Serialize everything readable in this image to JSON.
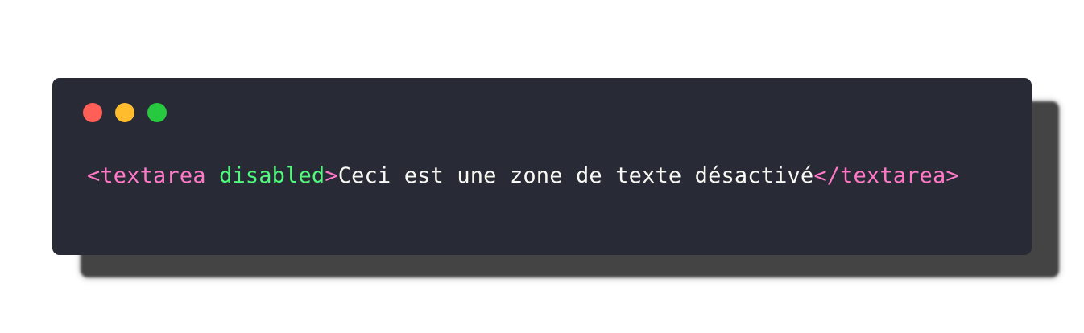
{
  "colors": {
    "window_bg": "#282a36",
    "shadow": "#444444",
    "close": "#ff5f56",
    "minimize": "#ffbd2e",
    "maximize": "#27c93f",
    "tag": "#ff79c6",
    "attribute": "#50fa7b",
    "text": "#f8f8f2"
  },
  "window_controls": [
    {
      "name": "close",
      "icon": "red-dot"
    },
    {
      "name": "minimize",
      "icon": "yellow-dot"
    },
    {
      "name": "maximize",
      "icon": "green-dot"
    }
  ],
  "code": {
    "open_tag": "<textarea ",
    "attribute": "disabled",
    "open_tag_close": ">",
    "content": "Ceci est une zone de texte désactivé",
    "close_tag": "</textarea>"
  }
}
